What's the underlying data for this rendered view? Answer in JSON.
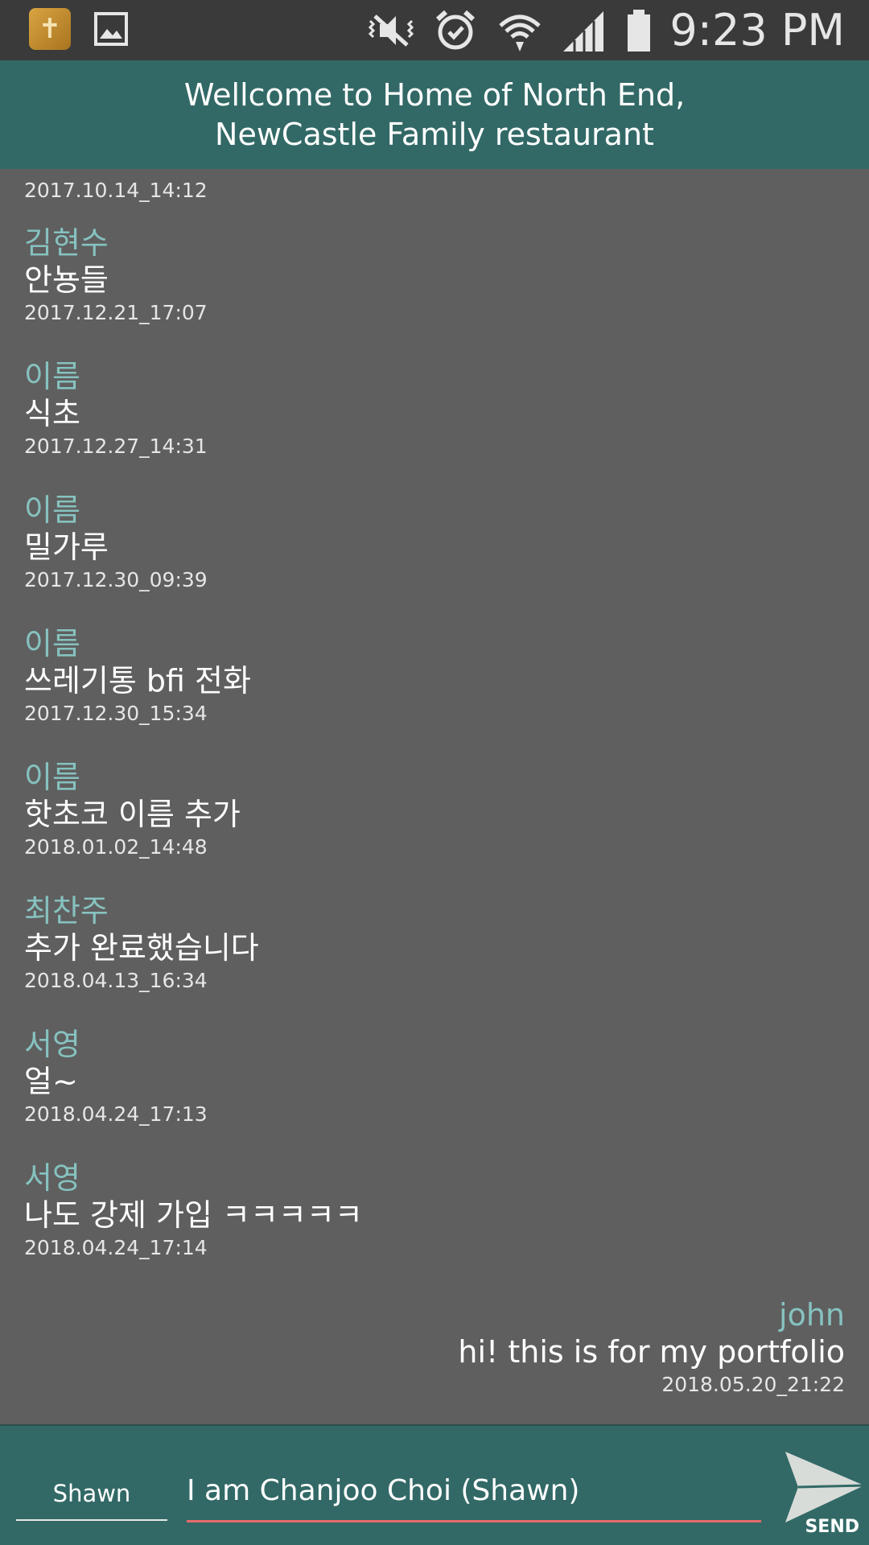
{
  "status_bar": {
    "time": "9:23 PM",
    "icons": [
      "app-icon",
      "gallery-icon",
      "mute-icon",
      "alarm-icon",
      "wifi-icon",
      "signal-icon",
      "battery-icon"
    ]
  },
  "header": {
    "line1": "Wellcome to Home of North End,",
    "line2": "NewCastle Family restaurant"
  },
  "messages": {
    "first_time": "2017.10.14_14:12",
    "items": [
      {
        "name": "김현수",
        "text": "안뇽들",
        "time": "2017.12.21_17:07"
      },
      {
        "name": "이름",
        "text": "식초",
        "time": "2017.12.27_14:31"
      },
      {
        "name": "이름",
        "text": "밀가루",
        "time": "2017.12.30_09:39"
      },
      {
        "name": "이름",
        "text": "쓰레기통 bfi 전화",
        "time": "2017.12.30_15:34"
      },
      {
        "name": "이름",
        "text": "핫초코  이름 추가",
        "time": "2018.01.02_14:48"
      },
      {
        "name": "최찬주",
        "text": "추가 완료했습니다",
        "time": "2018.04.13_16:34"
      },
      {
        "name": "서영",
        "text": "얼~",
        "time": "2018.04.24_17:13"
      },
      {
        "name": "서영",
        "text": "나도 강제 가입 ㅋㅋㅋㅋㅋ",
        "time": "2018.04.24_17:14"
      },
      {
        "name": "john",
        "text": "hi! this is for my portfolio",
        "time": "2018.05.20_21:22"
      }
    ]
  },
  "input": {
    "name_value": "Shawn",
    "message_value": "I am Chanjoo Choi (Shawn)",
    "send_label": "SEND"
  },
  "colors": {
    "background": "#5f5f5f",
    "header": "#326966",
    "name_text": "#86c2bf",
    "input_underline": "#e86a6a"
  }
}
